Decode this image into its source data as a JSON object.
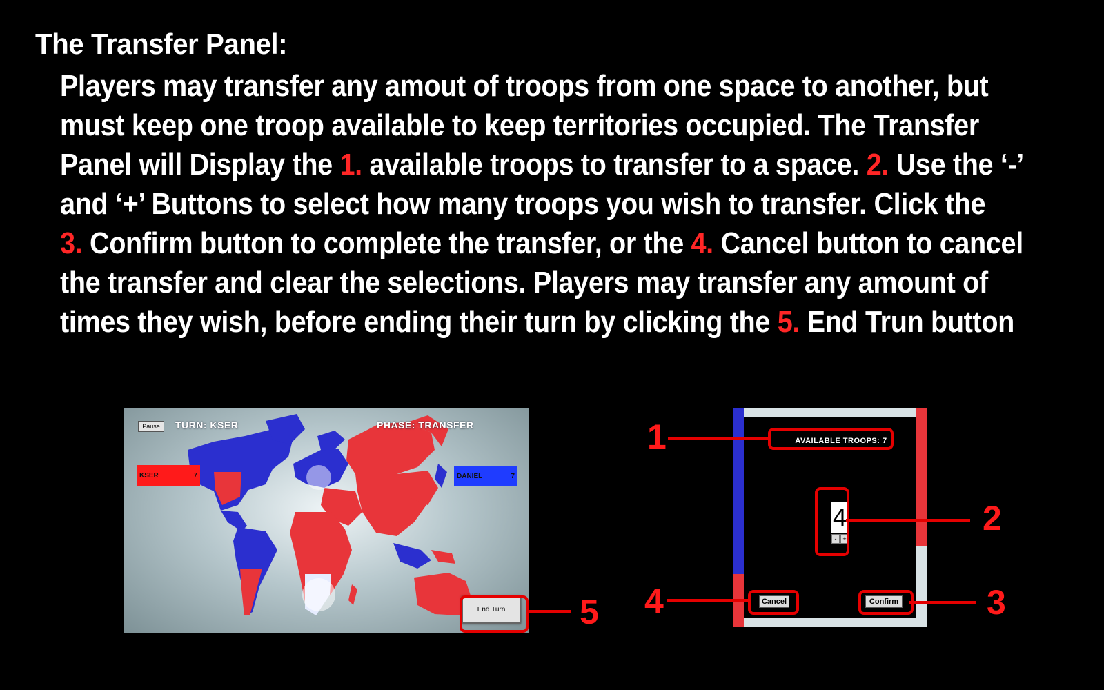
{
  "heading": "The Transfer Panel:",
  "body": {
    "l1": "Players may transfer any amout of troops from one space to another, but",
    "l2": "must keep one troop available to keep territories occupied. The Transfer",
    "l3a": "Panel will Display the ",
    "n1": "1.",
    "l3b": " available troops to transfer to a space. ",
    "n2": "2.",
    "l3c": " Use the ‘-’",
    "l4": "and ‘+’ Buttons to select how many troops you wish to transfer. Click the",
    "n3": "3.",
    "l5a": " Confirm button to complete the transfer, or the ",
    "n4": "4.",
    "l5b": " Cancel button to cancel",
    "l6": "the transfer and clear the selections. Players may transfer any amount of",
    "l7a": "times they wish, before ending their turn by clicking the ",
    "n5": "5.",
    "l7b": " End Trun button"
  },
  "game": {
    "pause_label": "Pause",
    "turn_label": "TURN: KSER",
    "phase_label": "PHASE: TRANSFER",
    "player1": {
      "name": "KSER",
      "count": "7",
      "color": "#ff1a1a"
    },
    "player2": {
      "name": "DANIEL",
      "count": "7",
      "color": "#1f3cff"
    },
    "end_turn_label": "End Turn"
  },
  "panel": {
    "available_label": "AVAILABLE TROOPS: 7",
    "stepper_value": "4",
    "minus_label": "-",
    "plus_label": "+",
    "cancel_label": "Cancel",
    "confirm_label": "Confirm"
  },
  "callouts": {
    "c1": "1",
    "c2": "2",
    "c3": "3",
    "c4": "4",
    "c5": "5"
  },
  "colors": {
    "accent_red": "#ff2626",
    "territory_red": "#e8353a",
    "territory_blue": "#2b2fcf"
  }
}
